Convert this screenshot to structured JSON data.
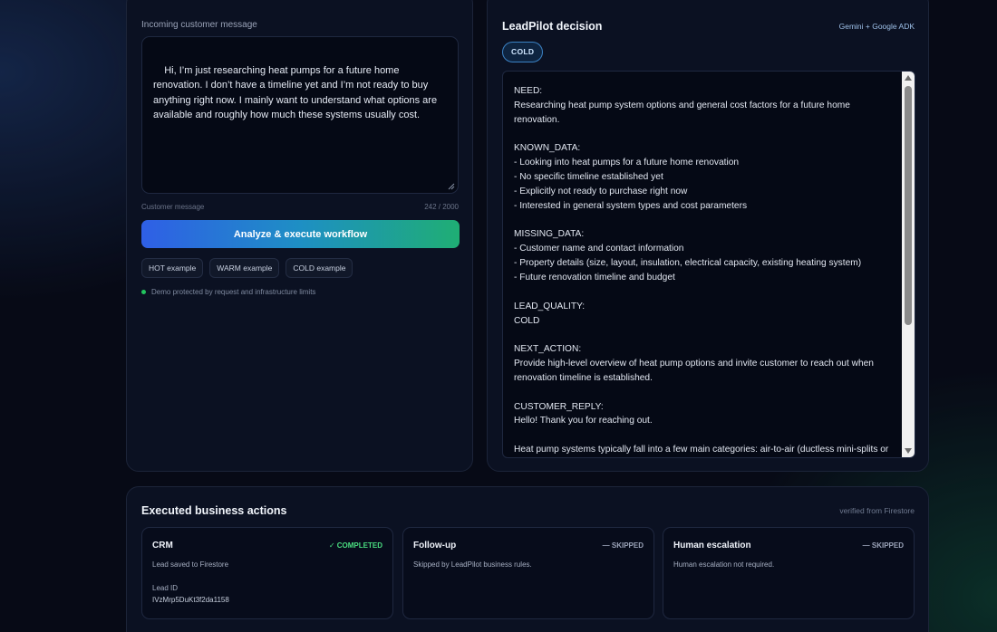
{
  "input_panel": {
    "label": "Incoming customer message",
    "message": "Hi, I’m just researching heat pumps for a future home renovation. I don’t have a timeline yet and I’m not ready to buy anything right now. I mainly want to understand what options are available and roughly how much these systems usually cost.",
    "footer_label": "Customer message",
    "char_count": "242 / 2000",
    "analyze_button": "Analyze & execute workflow",
    "examples": [
      "HOT example",
      "WARM example",
      "COLD example"
    ],
    "demo_note": "Demo protected by request and infrastructure limits",
    "status_dot_color": "#22c55e"
  },
  "decision_panel": {
    "title": "LeadPilot decision",
    "powered_by": "Gemini + Google ADK",
    "badge": "COLD",
    "output": "NEED:\nResearching heat pump system options and general cost factors for a future home renovation.\n\nKNOWN_DATA:\n- Looking into heat pumps for a future home renovation\n- No specific timeline established yet\n- Explicitly not ready to purchase right now\n- Interested in general system types and cost parameters\n\nMISSING_DATA:\n- Customer name and contact information\n- Property details (size, layout, insulation, electrical capacity, existing heating system)\n- Future renovation timeline and budget\n\nLEAD_QUALITY:\nCOLD\n\nNEXT_ACTION:\nProvide high-level overview of heat pump options and invite customer to reach out when renovation timeline is established.\n\nCUSTOMER_REPLY:\nHello! Thank you for reaching out.\n\nHeat pump systems typically fall into a few main categories: air-to-air (ductless mini-splits or central ducted systems), air-to-water (hydronic systems), and ground-source (geothermal)."
  },
  "actions_panel": {
    "title": "Executed business actions",
    "verified": "verified from Firestore",
    "cards": [
      {
        "title": "CRM",
        "status": "✓ COMPLETED",
        "desc": "Lead saved to Firestore",
        "sublabel": "Lead ID",
        "subvalue": "IVzMrp5DuKt3f2da1158"
      },
      {
        "title": "Follow-up",
        "status": "— SKIPPED",
        "desc": "Skipped by LeadPilot business rules."
      },
      {
        "title": "Human escalation",
        "status": "— SKIPPED",
        "desc": "Human escalation not required."
      }
    ]
  },
  "colors": {
    "completed": "#4ade80",
    "accent_start": "#2f5fe6",
    "accent_end": "#1fae74",
    "badge_border": "#3b82c4"
  }
}
